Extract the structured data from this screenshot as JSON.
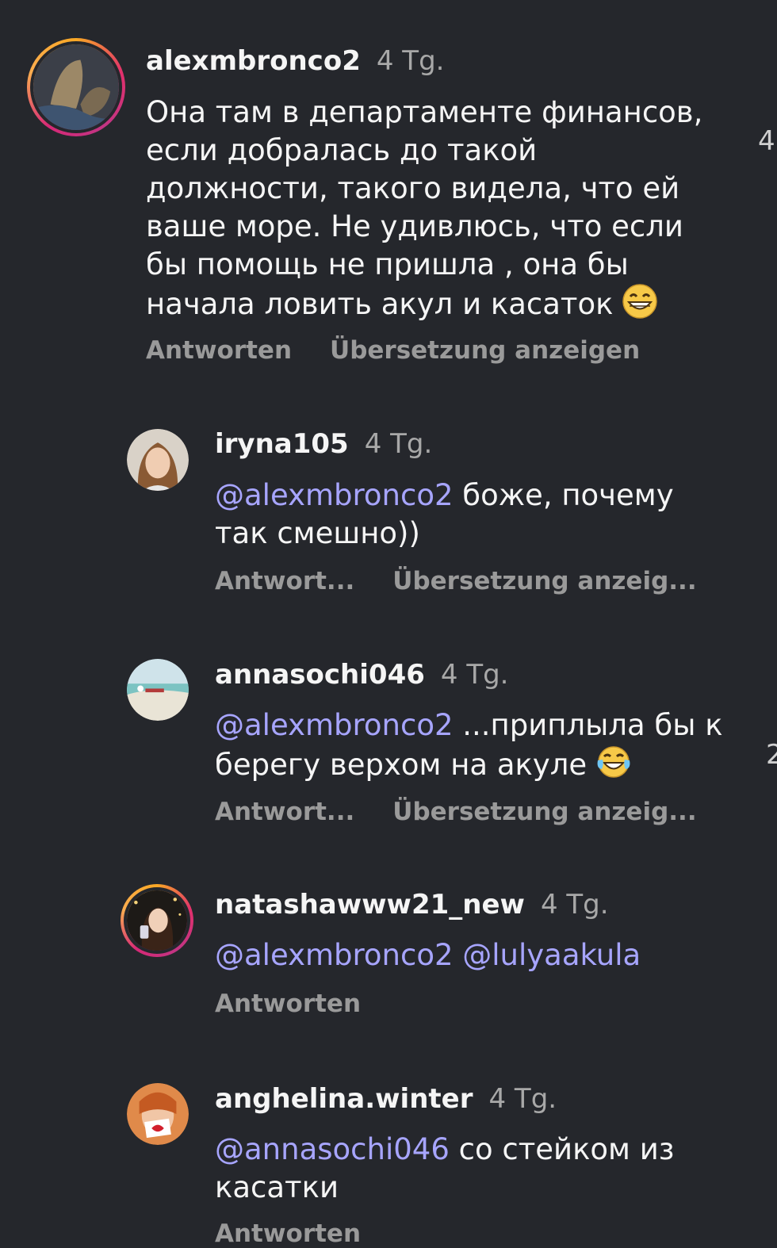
{
  "comments": [
    {
      "username": "alexmbronco2",
      "time": "4 Tg.",
      "text": "Она там в департаменте финансов, если добралась до такой должности, такого видела, что ей ваше море. Не удивлюсь, что если бы помощь не пришла , она бы начала ловить акул и касаток",
      "emoji": "grinning-face-emoji",
      "reply_label": "Antworten",
      "translate_label": "Übersetzung anzeigen"
    },
    {
      "username": "iryna105",
      "time": "4 Tg.",
      "mention": "@alexmbronco2",
      "text": " боже, почему так смешно))",
      "reply_label": "Antwort...",
      "translate_label": "Übersetzung anzeig..."
    },
    {
      "username": "annasochi046",
      "time": "4 Tg.",
      "mention": "@alexmbronco2",
      "text": " ...приплыла бы к берегу верхом на акуле",
      "emoji": "tears-of-joy-emoji",
      "reply_label": "Antwort...",
      "translate_label": "Übersetzung anzeig..."
    },
    {
      "username": "natashawww21_new",
      "time": "4 Tg.",
      "mention": "@alexmbronco2",
      "mention2": "@lulyaakula",
      "reply_label": "Antworten"
    },
    {
      "username": "anghelina.winter",
      "time": "4 Tg.",
      "mention": "@annasochi046",
      "text": " со стейком из касатки",
      "reply_label": "Antworten"
    }
  ],
  "right_edge": {
    "frag1": "4",
    "frag2": "2"
  },
  "colors": {
    "background": "#25272c",
    "mention": "#a7a5ff",
    "secondary": "#9a9a9a"
  }
}
